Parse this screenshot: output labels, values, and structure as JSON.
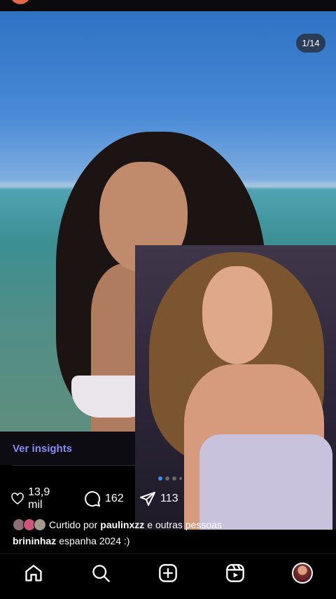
{
  "photo": {
    "counter": "1/14",
    "alt": "Duas meninas sorrindo na praia"
  },
  "insights": {
    "label": "Ver insights"
  },
  "carousel": {
    "dots": 5,
    "active_index": 0
  },
  "actions": {
    "likes_count": "13,9 mil",
    "comments_count": "162",
    "shares_count": "113"
  },
  "liked_by": {
    "prefix": "Curtido por",
    "user": "paulinxzz",
    "suffix": "e outras pessoas"
  },
  "caption": {
    "username": "brininhaz",
    "text": "espanha 2024 :)"
  },
  "tabbar": {
    "items": [
      "home-icon",
      "search-icon",
      "create-icon",
      "reels-icon",
      "profile-avatar"
    ]
  },
  "colors": {
    "accent_link": "#8a8cf3",
    "active_dot": "#3d8df3",
    "background": "#000000"
  }
}
